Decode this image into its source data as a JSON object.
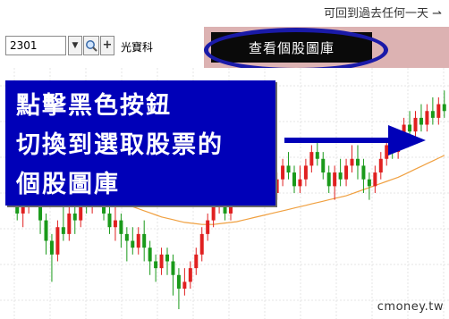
{
  "header": {
    "hint": "可回到過去任何一天 ⇀"
  },
  "toolbar": {
    "stock_code": "2301",
    "stock_name": "光寶科",
    "dropdown_icon": "chevron-down-icon",
    "search_icon": "magnifier-icon",
    "add_label": "+",
    "view_library_label": "查看個股圖庫"
  },
  "callout": {
    "lines": [
      "點擊黑色按鈕",
      "切換到選取股票的",
      "個股圖庫"
    ],
    "arrow_icon": "arrow-right-icon"
  },
  "watermark": "cmoney.tw",
  "colors": {
    "toolbar_bg": "#dcb2b2",
    "callout_bg": "#0000b8",
    "ellipse": "#1a1aa8",
    "candle_up": "#e02020",
    "candle_down": "#1a9a1a",
    "ma_line": "#f0a040"
  },
  "chart_data": {
    "type": "candlestick",
    "candles": [
      [
        52,
        50,
        54,
        49
      ],
      [
        50,
        51,
        52,
        48
      ],
      [
        51,
        53,
        54,
        50
      ],
      [
        53,
        52,
        55,
        51
      ],
      [
        52,
        49,
        53,
        47
      ],
      [
        49,
        46,
        50,
        44
      ],
      [
        46,
        44,
        47,
        40
      ],
      [
        44,
        48,
        49,
        43
      ],
      [
        48,
        47,
        51,
        46
      ],
      [
        47,
        50,
        51,
        46
      ],
      [
        50,
        49,
        52,
        47
      ],
      [
        49,
        52,
        53,
        48
      ],
      [
        52,
        51,
        54,
        50
      ],
      [
        51,
        54,
        56,
        50
      ],
      [
        54,
        53,
        56,
        52
      ],
      [
        53,
        50,
        54,
        49
      ],
      [
        50,
        48,
        51,
        47
      ],
      [
        48,
        49,
        51,
        46
      ],
      [
        49,
        47,
        50,
        45
      ],
      [
        47,
        46,
        48,
        43
      ],
      [
        46,
        45,
        48,
        44
      ],
      [
        45,
        47,
        48,
        44
      ],
      [
        47,
        45,
        49,
        43
      ],
      [
        45,
        43,
        46,
        41
      ],
      [
        43,
        42,
        44,
        40
      ],
      [
        42,
        44,
        45,
        41
      ],
      [
        44,
        43,
        45,
        41
      ],
      [
        43,
        41,
        44,
        38
      ],
      [
        41,
        39,
        42,
        36
      ],
      [
        39,
        40,
        42,
        38
      ],
      [
        40,
        42,
        43,
        39
      ],
      [
        42,
        44,
        45,
        41
      ],
      [
        44,
        47,
        48,
        43
      ],
      [
        47,
        49,
        50,
        46
      ],
      [
        49,
        51,
        52,
        48
      ],
      [
        51,
        52,
        54,
        50
      ],
      [
        52,
        50,
        53,
        49
      ],
      [
        50,
        53,
        54,
        49
      ],
      [
        53,
        54,
        56,
        52
      ],
      [
        54,
        53,
        56,
        51
      ],
      [
        53,
        55,
        56,
        52
      ],
      [
        55,
        54,
        57,
        53
      ],
      [
        54,
        56,
        57,
        53
      ],
      [
        56,
        55,
        58,
        54
      ],
      [
        55,
        53,
        56,
        52
      ],
      [
        53,
        55,
        56,
        52
      ],
      [
        55,
        57,
        58,
        54
      ],
      [
        57,
        56,
        59,
        55
      ],
      [
        56,
        54,
        57,
        53
      ],
      [
        54,
        55,
        57,
        53
      ],
      [
        55,
        57,
        58,
        54
      ],
      [
        57,
        59,
        60,
        56
      ],
      [
        59,
        58,
        61,
        57
      ],
      [
        58,
        56,
        59,
        55
      ],
      [
        56,
        54,
        57,
        53
      ],
      [
        54,
        56,
        57,
        52
      ],
      [
        56,
        55,
        58,
        54
      ],
      [
        55,
        57,
        58,
        54
      ],
      [
        57,
        58,
        60,
        56
      ],
      [
        58,
        57,
        60,
        55
      ],
      [
        57,
        55,
        58,
        53
      ],
      [
        55,
        54,
        56,
        52
      ],
      [
        54,
        56,
        57,
        53
      ],
      [
        56,
        58,
        59,
        55
      ],
      [
        58,
        60,
        61,
        57
      ],
      [
        60,
        59,
        62,
        58
      ],
      [
        59,
        61,
        62,
        58
      ],
      [
        61,
        63,
        64,
        60
      ],
      [
        63,
        62,
        65,
        61
      ],
      [
        62,
        64,
        65,
        61
      ],
      [
        64,
        63,
        66,
        62
      ],
      [
        63,
        65,
        66,
        62
      ],
      [
        65,
        64,
        67,
        63
      ],
      [
        64,
        66,
        67,
        63
      ],
      [
        66,
        65,
        68,
        64
      ]
    ],
    "moving_average": [
      60,
      59.6,
      59.2,
      58.8,
      58.3,
      57.8,
      57.2,
      56.6,
      56,
      55.5,
      55,
      54.6,
      54.2,
      53.8,
      53.4,
      53,
      52.6,
      52.2,
      51.8,
      51.4,
      51,
      50.7,
      50.4,
      50.1,
      49.8,
      49.5,
      49.3,
      49.1,
      48.9,
      48.7,
      48.6,
      48.5,
      48.4,
      48.4,
      48.4,
      48.5,
      48.6,
      48.7,
      48.8,
      49,
      49.2,
      49.4,
      49.6,
      49.8,
      50,
      50.2,
      50.4,
      50.6,
      50.8,
      51,
      51.2,
      51.4,
      51.6,
      51.8,
      52,
      52.2,
      52.4,
      52.6,
      52.9,
      53.2,
      53.5,
      53.8,
      54.1,
      54.4,
      54.7,
      55,
      55.3,
      55.7,
      56.1,
      56.5,
      56.9,
      57.3,
      57.7,
      58.1,
      58.5
    ],
    "ylim": [
      36,
      70
    ],
    "grid": true
  }
}
